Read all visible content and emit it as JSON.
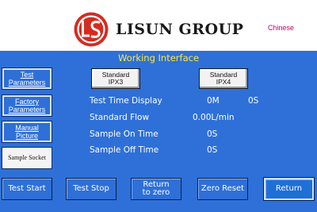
{
  "header": {
    "brand": "LISUN GROUP",
    "language_label": "Chinese",
    "logo_icon": "lisun-ls-logo-icon"
  },
  "screen": {
    "title": "Working Interface"
  },
  "sidebar": {
    "test_parameters": [
      "Test",
      "Parameters"
    ],
    "factory_parameters": [
      "Factory",
      "Parameters"
    ],
    "manual_picture": [
      "Manual",
      "Picture"
    ],
    "sample_socket": "Sample Socket"
  },
  "standards": {
    "ipx3": [
      "Standard",
      "IPX3"
    ],
    "ipx4": [
      "Standard",
      "IPX4"
    ]
  },
  "readouts": {
    "test_time_label": "Test Time Display",
    "test_time_minutes": "0M",
    "test_time_seconds": "0S",
    "flow_label": "Standard Flow",
    "flow_value": "0.00L/min",
    "sample_on_label": "Sample On Time",
    "sample_on_value": "0S",
    "sample_off_label": "Sample Off Time",
    "sample_off_value": "0S"
  },
  "footer": {
    "test_start": "Test Start",
    "test_stop": "Test Stop",
    "return_to_zero": [
      "Return",
      "to zero"
    ],
    "zero_reset": "Zero Reset",
    "return": "Return"
  },
  "colors": {
    "panel_blue": "#2e70d8",
    "title_yellow": "#ffe838",
    "logo_red": "#d62b1f",
    "chinese_magenta": "#c0006a"
  }
}
